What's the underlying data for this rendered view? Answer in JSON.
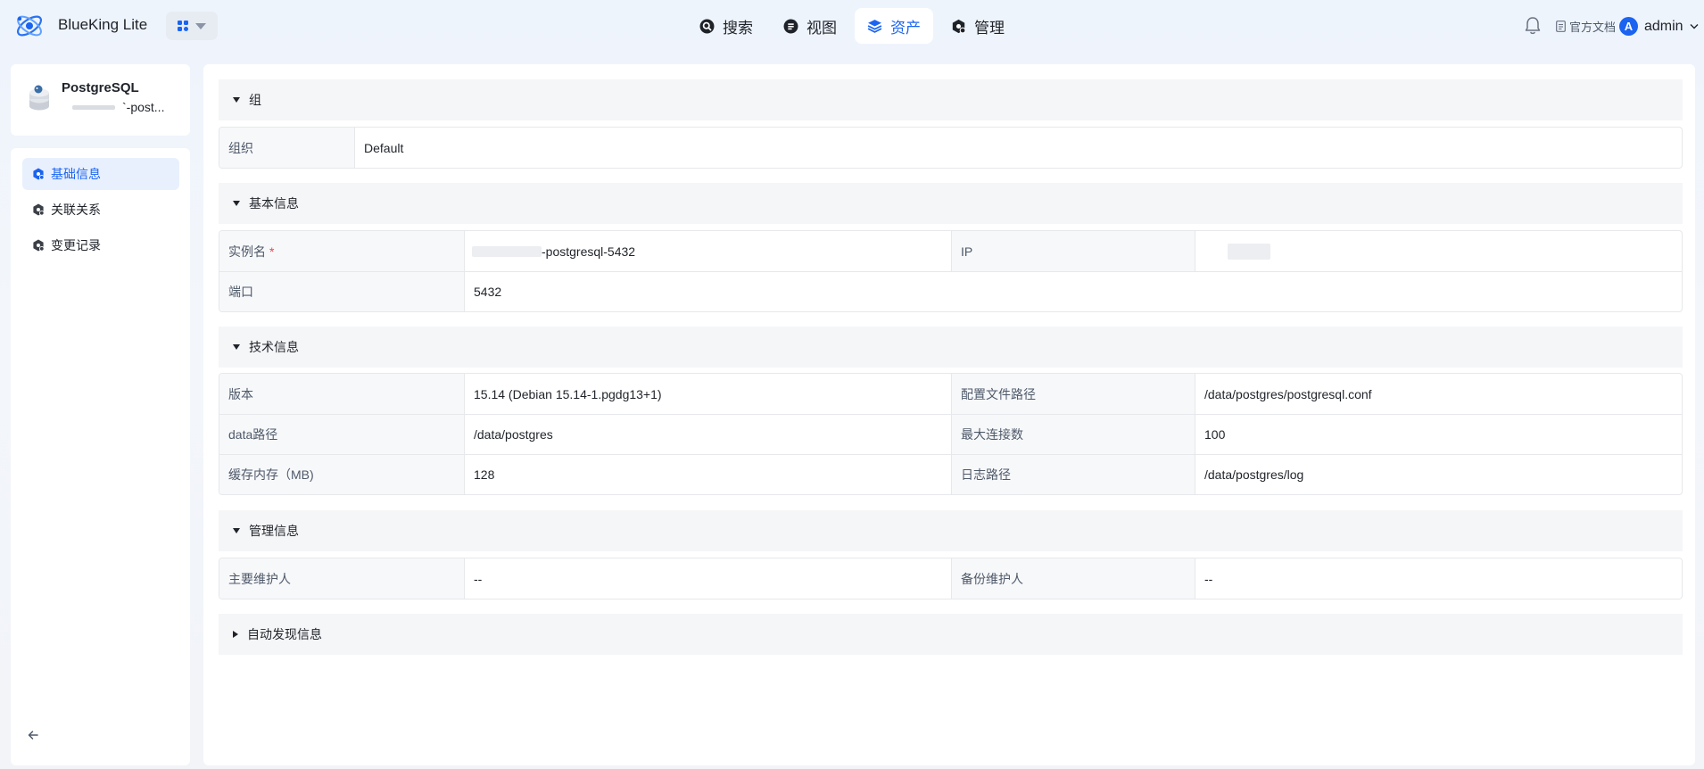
{
  "header": {
    "brand": "BlueKing Lite",
    "nav": [
      {
        "label": "搜索",
        "icon": "search-icon"
      },
      {
        "label": "视图",
        "icon": "view-icon"
      },
      {
        "label": "资产",
        "icon": "layers-icon",
        "active": true
      },
      {
        "label": "管理",
        "icon": "manage-icon"
      }
    ],
    "docs_label": "官方文档",
    "avatar_letter": "A",
    "username": "admin"
  },
  "sidebar": {
    "title": "PostgreSQL",
    "subtitle": "`-post...",
    "items": [
      {
        "label": "基础信息",
        "active": true
      },
      {
        "label": "关联关系"
      },
      {
        "label": "变更记录"
      }
    ]
  },
  "sections": {
    "group": {
      "title": "组",
      "rows": [
        {
          "label": "组织",
          "value": "Default"
        }
      ]
    },
    "basic": {
      "title": "基本信息",
      "instance_label": "实例名",
      "required_mark": "*",
      "instance_value": "-postgresql-5432",
      "ip_label": "IP",
      "port_label": "端口",
      "port_value": "5432"
    },
    "tech": {
      "title": "技术信息",
      "version_label": "版本",
      "version_value": "15.14 (Debian 15.14-1.pgdg13+1)",
      "conf_label": "配置文件路径",
      "conf_value": "/data/postgres/postgresql.conf",
      "data_label": "data路径",
      "data_value": "/data/postgres",
      "maxconn_label": "最大连接数",
      "maxconn_value": "100",
      "cache_label": "缓存内存（MB)",
      "cache_value": "128",
      "log_label": "日志路径",
      "log_value": "/data/postgres/log"
    },
    "manage": {
      "title": "管理信息",
      "primary_label": "主要维护人",
      "primary_value": "--",
      "backup_label": "备份维护人",
      "backup_value": "--"
    },
    "auto": {
      "title": "自动发现信息"
    }
  },
  "colors": {
    "accent": "#1a64f0",
    "required": "#e5484d"
  }
}
